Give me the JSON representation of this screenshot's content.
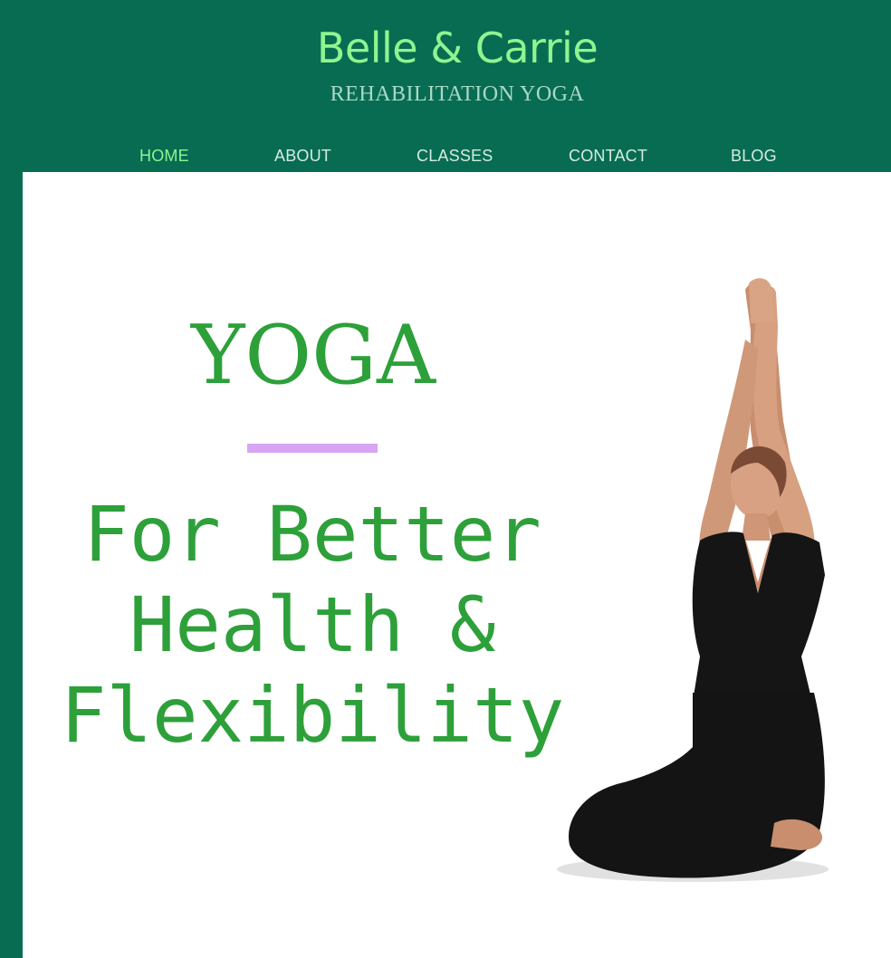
{
  "header": {
    "title": "Belle & Carrie",
    "subtitle": "REHABILITATION YOGA"
  },
  "nav": {
    "items": [
      {
        "label": "HOME",
        "active": true
      },
      {
        "label": "ABOUT",
        "active": false
      },
      {
        "label": "CLASSES",
        "active": false
      },
      {
        "label": "CONTACT",
        "active": false
      },
      {
        "label": "BLOG",
        "active": false
      }
    ]
  },
  "hero": {
    "heading": "YOGA",
    "tagline_lines": [
      "For Better",
      "Health &",
      "Flexibility"
    ]
  },
  "colors": {
    "header_bg": "#086c52",
    "brand_title": "#8ef58f",
    "nav_active": "#8ef58f",
    "nav_text": "#d4ecdf",
    "hero_text": "#2da03a",
    "divider": "#d7a5f3"
  }
}
